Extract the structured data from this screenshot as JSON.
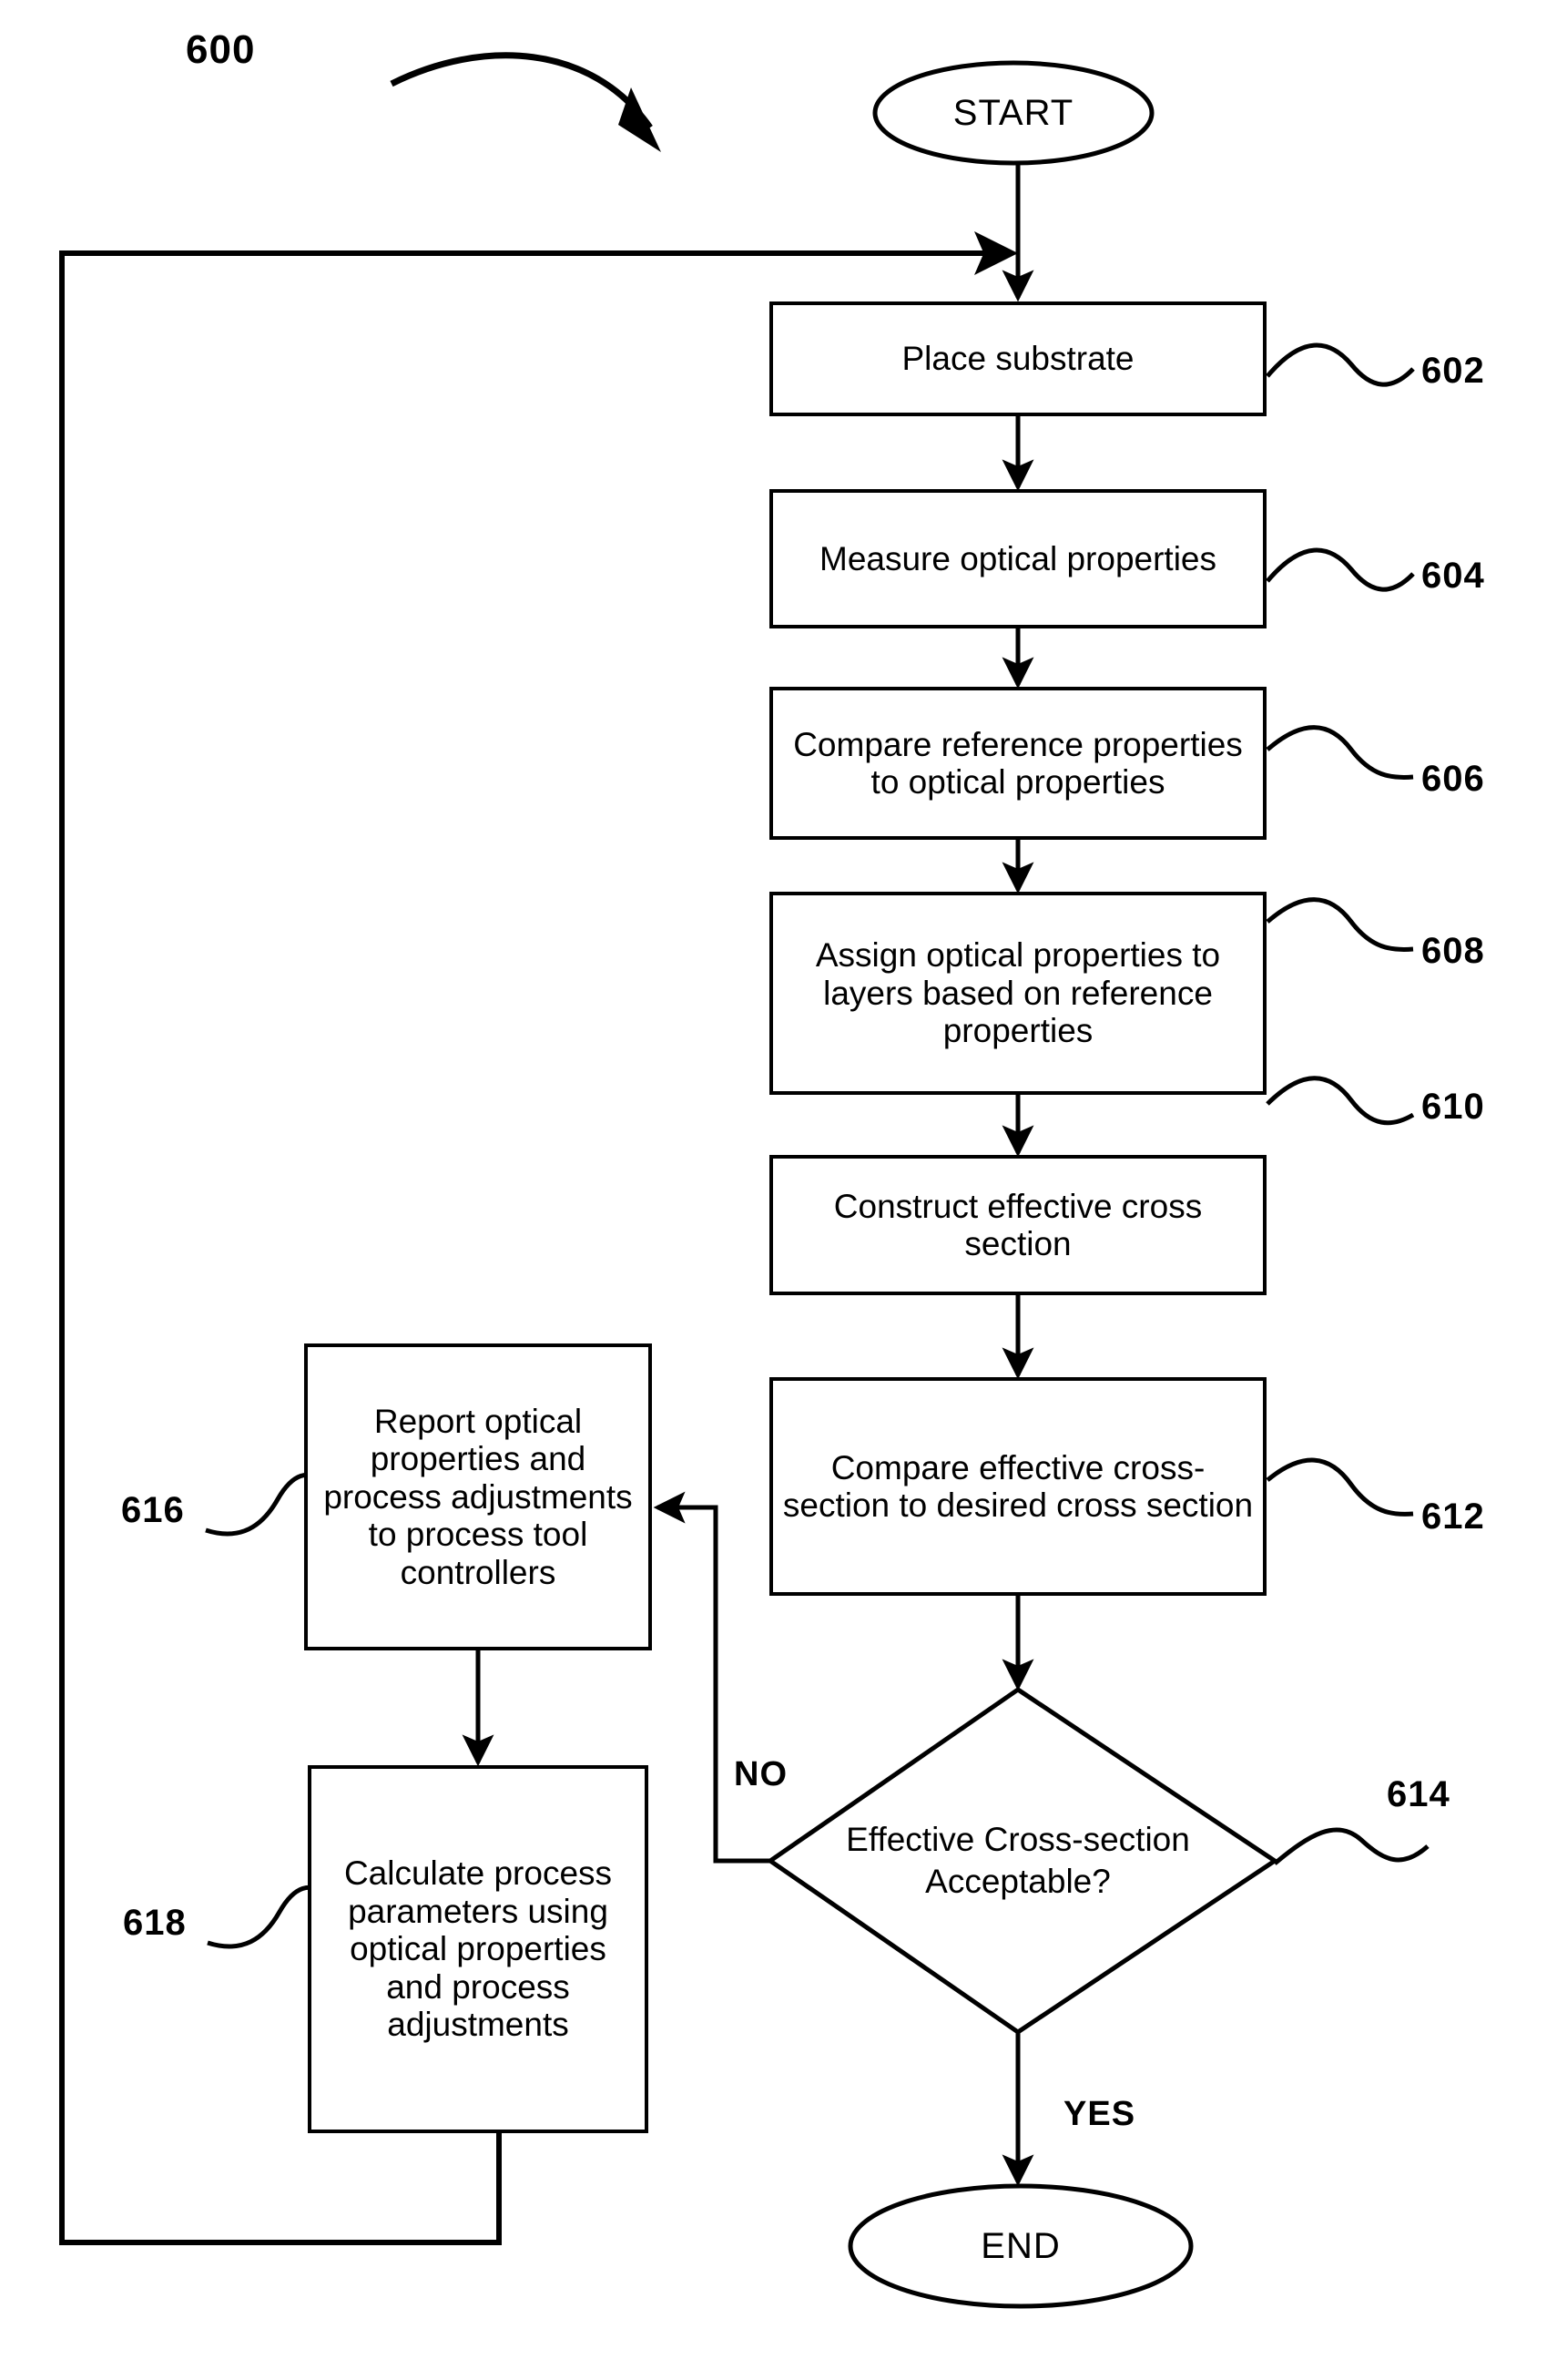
{
  "figure": {
    "number": "600",
    "type": "flowchart"
  },
  "nodes": {
    "start": {
      "label": "START",
      "ref": ""
    },
    "end": {
      "label": "END",
      "ref": ""
    },
    "step_602": {
      "label": "Place substrate",
      "ref": "602"
    },
    "step_604": {
      "label": "Measure optical properties",
      "ref": "604"
    },
    "step_606": {
      "label": "Compare reference properties to optical properties",
      "ref": "606"
    },
    "step_608": {
      "label": "Assign optical properties to layers based on reference properties",
      "ref": "608"
    },
    "step_610": {
      "label": "Construct effective cross section",
      "ref": "610"
    },
    "step_612": {
      "label": "Compare effective cross-section to desired cross section",
      "ref": "612"
    },
    "decision_614": {
      "label": "Effective Cross-section Acceptable?",
      "ref": "614"
    },
    "step_616": {
      "label": "Report optical properties and process adjustments to process tool controllers",
      "ref": "616"
    },
    "step_618": {
      "label": "Calculate process parameters using optical properties and process adjustments",
      "ref": "618"
    }
  },
  "branches": {
    "no": "NO",
    "yes": "YES"
  },
  "colors": {
    "stroke": "#000000",
    "background": "#ffffff"
  }
}
